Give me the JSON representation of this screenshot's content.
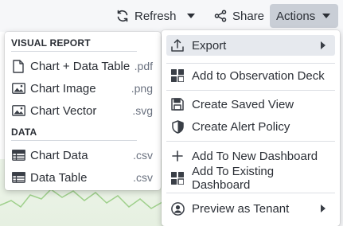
{
  "toolbar": {
    "refresh_label": "Refresh",
    "share_label": "Share",
    "actions_label": "Actions"
  },
  "export_menu": {
    "visual_report": {
      "heading": "VISUAL REPORT",
      "items": [
        {
          "label": "Chart + Data Table",
          "ext": ".pdf",
          "icon": "document-icon"
        },
        {
          "label": "Chart Image",
          "ext": ".png",
          "icon": "image-icon"
        },
        {
          "label": "Chart Vector",
          "ext": ".svg",
          "icon": "image-icon"
        }
      ]
    },
    "data": {
      "heading": "DATA",
      "items": [
        {
          "label": "Chart Data",
          "ext": ".csv",
          "icon": "table-icon"
        },
        {
          "label": "Data Table",
          "ext": ".csv",
          "icon": "table-icon"
        }
      ]
    }
  },
  "actions_menu": {
    "items": [
      {
        "label": "Export",
        "icon": "export-icon",
        "submenu": true,
        "highlighted": true
      },
      {
        "label": "Add to Observation Deck",
        "icon": "grid-icon"
      },
      {
        "label": "Create Saved View",
        "icon": "save-icon"
      },
      {
        "label": "Create Alert Policy",
        "icon": "shield-icon"
      },
      {
        "label": "Add To New Dashboard",
        "icon": "plus-icon"
      },
      {
        "label": "Add To Existing Dashboard",
        "icon": "grid-icon"
      },
      {
        "label": "Preview as Tenant",
        "icon": "user-circle-icon",
        "submenu": true
      }
    ]
  },
  "colors": {
    "actions_button_bg": "#c9ced6",
    "highlight_bg": "#e6e9ee",
    "text": "#2b2f36",
    "muted": "#6b7280"
  }
}
